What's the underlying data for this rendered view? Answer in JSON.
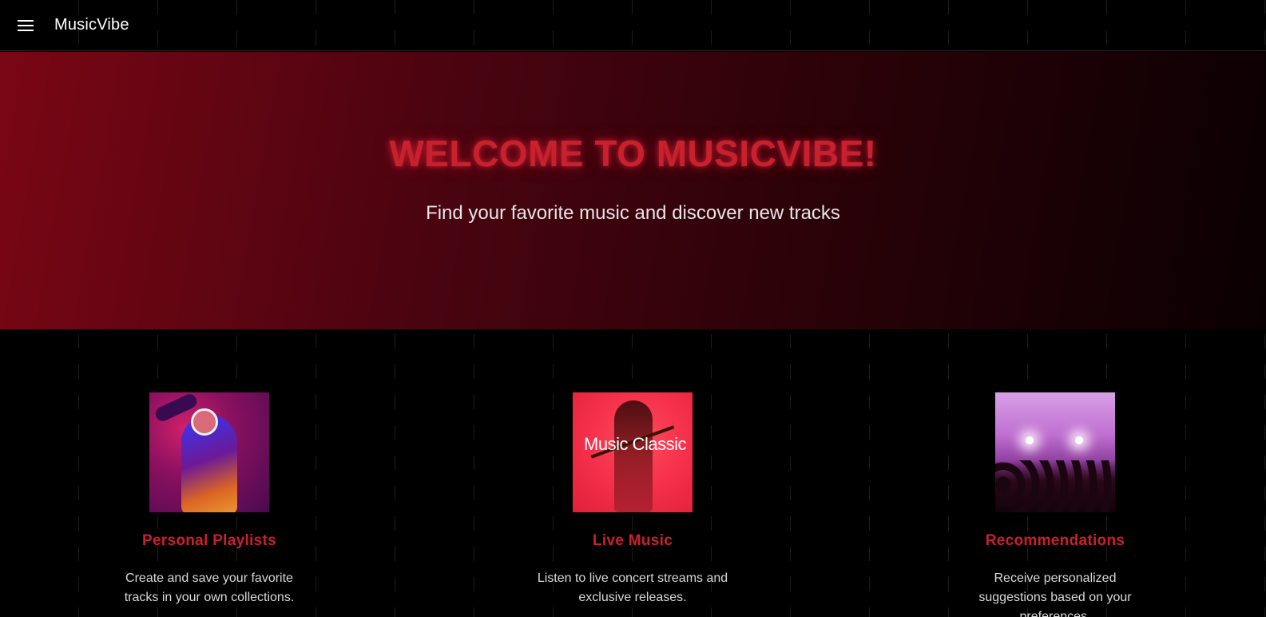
{
  "app": {
    "brand": "MusicVibe"
  },
  "hero": {
    "title": "WELCOME TO MUSICVIBE!",
    "subtitle": "Find your favorite music and discover new tracks"
  },
  "features": [
    {
      "title": "Personal Playlists",
      "description": "Create and save your favorite tracks in your own collections.",
      "image": "playlist-image"
    },
    {
      "title": "Live Music",
      "description": "Listen to live concert streams and exclusive releases.",
      "image": "live-music-image",
      "image_caption": "Music Classic"
    },
    {
      "title": "Recommendations",
      "description": "Receive personalized suggestions based on your preferences.",
      "image": "recommendations-image"
    }
  ],
  "colors": {
    "accent": "#c9202e",
    "background": "#000000",
    "hero_gradient_start": "#7a0614",
    "hero_gradient_end": "#0a0002"
  },
  "icons": {
    "menu": "menu-icon"
  }
}
